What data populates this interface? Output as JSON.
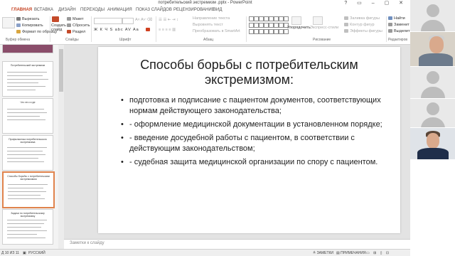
{
  "window": {
    "document_title": "потребительский экстремизм .pptx - PowerPoint"
  },
  "ribbon_tabs": {
    "file": "ЙЛ",
    "items": [
      "ГЛАВНАЯ",
      "ВСТАВКА",
      "ДИЗАЙН",
      "ПЕРЕХОДЫ",
      "АНИМАЦИЯ",
      "ПОКАЗ СЛАЙДОВ",
      "РЕЦЕНЗИРОВАНИЕ",
      "ВИД"
    ]
  },
  "ribbon": {
    "clipboard": {
      "cut": "Вырезать",
      "copy": "Копировать",
      "format_painter": "Формат по образцу",
      "group": "Буфер обмена"
    },
    "slides": {
      "new_slide": "Создать слайд",
      "layout": "Макет",
      "reset": "Сбросить",
      "section": "Раздел",
      "group": "Слайды"
    },
    "font": {
      "format_row": "Ж К Ч S abc AV Aa",
      "group": "Шрифт"
    },
    "paragraph": {
      "text_direction": "Направление текста",
      "align_text": "Выровнять текст",
      "smartart": "Преобразовать в SmartArt",
      "group": "Абзац"
    },
    "drawing": {
      "arrange": "Упорядочить",
      "quick_styles": "Экспресс-стили",
      "fill": "Заливка фигуры",
      "outline": "Контур фигур",
      "effects": "Эффекты фигуры",
      "group": "Рисование"
    },
    "editing": {
      "find": "Найти",
      "replace": "Заменит",
      "select": "Выделит",
      "group": "Редактиров"
    }
  },
  "thumbnails": [
    {
      "number": "",
      "title": ""
    },
    {
      "number": "",
      "title": "Потребительский экстремизм"
    },
    {
      "number": "",
      "title": "Что это и где"
    },
    {
      "number": "",
      "title": "Профилактика потребительского экстремизма"
    },
    {
      "number": "",
      "title": "Способы борьбы с потребительским экстремизмом",
      "selected": true
    },
    {
      "number": "",
      "title": "Задачи по потребительскому экстремизму"
    }
  ],
  "slide": {
    "title": "Способы борьбы с потребительским экстремизмом:",
    "bullets": [
      " подготовка и подписание с пациентом документов, соответствующих нормам действующего законодательства;",
      "- оформление медицинской документации в установленном порядке;",
      "- введение досудебной работы с пациентом, в соответствии с действующим законодательством;",
      "- судебная защита медицинской организации по спору с пациентом."
    ],
    "bullet_glyph": "•"
  },
  "notes": {
    "placeholder": "Заметки к слайду"
  },
  "statusbar": {
    "slide_counter": "Д 10 ИЗ 11",
    "language": "РУССКИЙ",
    "notes_button": "ЗАМЕТКИ",
    "comments_button": "ПРИМЕЧАНИЯ"
  },
  "colors": {
    "accent": "#c43e1c",
    "selection": "#e0834c"
  }
}
